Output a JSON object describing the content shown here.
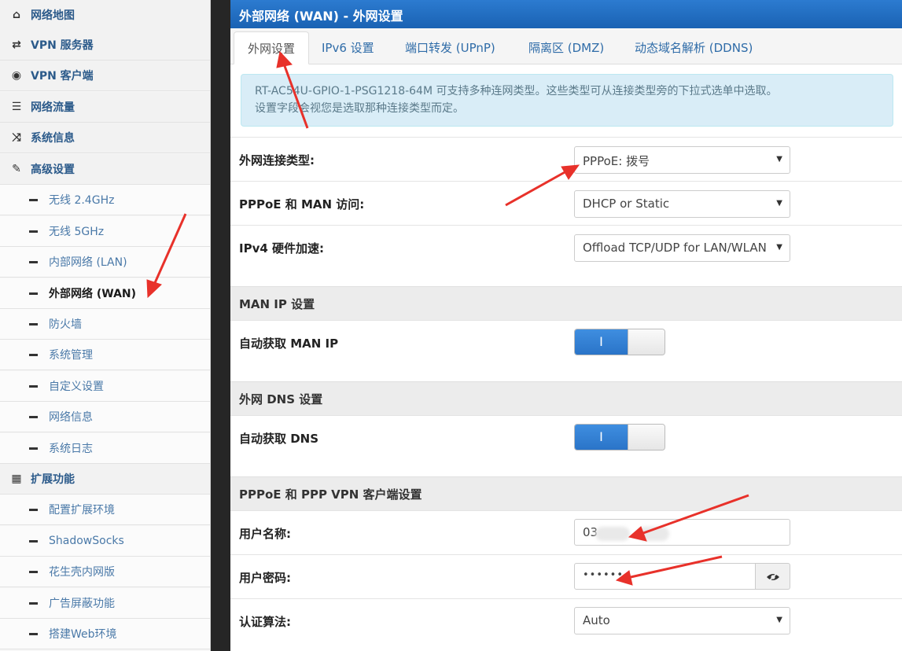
{
  "sidebar": {
    "items": [
      {
        "label": "网络地图",
        "icon": "home-icon",
        "glyph": "⌂",
        "type": "top"
      },
      {
        "label": "VPN 服务器",
        "icon": "swap-icon",
        "glyph": "⇄",
        "type": "top"
      },
      {
        "label": "VPN 客户端",
        "icon": "globe-icon",
        "glyph": "◉",
        "type": "top"
      },
      {
        "label": "网络流量",
        "icon": "list-icon",
        "glyph": "☰",
        "type": "top"
      },
      {
        "label": "系统信息",
        "icon": "shuffle-icon",
        "glyph": "⤨",
        "type": "top"
      },
      {
        "label": "高级设置",
        "icon": "wrench-icon",
        "glyph": "✎",
        "type": "top"
      },
      {
        "label": "无线 2.4GHz",
        "type": "sub"
      },
      {
        "label": "无线 5GHz",
        "type": "sub"
      },
      {
        "label": "内部网络 (LAN)",
        "type": "sub"
      },
      {
        "label": "外部网络 (WAN)",
        "type": "sub",
        "active": true
      },
      {
        "label": "防火墙",
        "type": "sub"
      },
      {
        "label": "系统管理",
        "type": "sub"
      },
      {
        "label": "自定义设置",
        "type": "sub"
      },
      {
        "label": "网络信息",
        "type": "sub"
      },
      {
        "label": "系统日志",
        "type": "sub"
      },
      {
        "label": "扩展功能",
        "icon": "grid-icon",
        "glyph": "▦",
        "type": "top"
      },
      {
        "label": "配置扩展环境",
        "type": "sub"
      },
      {
        "label": "ShadowSocks",
        "type": "sub"
      },
      {
        "label": "花生壳内网版",
        "type": "sub"
      },
      {
        "label": "广告屏蔽功能",
        "type": "sub"
      },
      {
        "label": "搭建Web环境",
        "type": "sub"
      }
    ]
  },
  "header": {
    "title": "外部网络 (WAN) - 外网设置"
  },
  "tabs": [
    {
      "label": "外网设置"
    },
    {
      "label": "IPv6 设置"
    },
    {
      "label": "端口转发 (UPnP)"
    },
    {
      "label": "隔离区 (DMZ)"
    },
    {
      "label": "动态域名解析 (DDNS)"
    }
  ],
  "info": {
    "line1": "RT-AC54U-GPIO-1-PSG1218-64M 可支持多种连网类型。这些类型可从连接类型旁的下拉式选单中选取。",
    "line2": "设置字段会视您是选取那种连接类型而定。"
  },
  "form": {
    "wan_type": {
      "label": "外网连接类型:",
      "value": "PPPoE: 拨号"
    },
    "man_access": {
      "label": "PPPoE 和 MAN 访问:",
      "value": "DHCP or Static"
    },
    "hw_accel": {
      "label": "IPv4 硬件加速:",
      "value": "Offload TCP/UDP for LAN/WLAN"
    },
    "man_ip_section": "MAN IP 设置",
    "auto_man_ip": {
      "label": "自动获取 MAN IP",
      "toggle_text": "I",
      "on": true
    },
    "dns_section": "外网 DNS 设置",
    "auto_dns": {
      "label": "自动获取 DNS",
      "toggle_text": "I",
      "on": true
    },
    "pppoe_section": "PPPoE 和 PPP VPN 客户端设置",
    "username": {
      "label": "用户名称:",
      "value_visible_prefix": "03"
    },
    "password": {
      "label": "用户密码:",
      "value": "••••••"
    },
    "auth": {
      "label": "认证算法:",
      "value": "Auto"
    }
  },
  "colors": {
    "accent": "#1a62b3",
    "annotation": "#e8312a"
  }
}
